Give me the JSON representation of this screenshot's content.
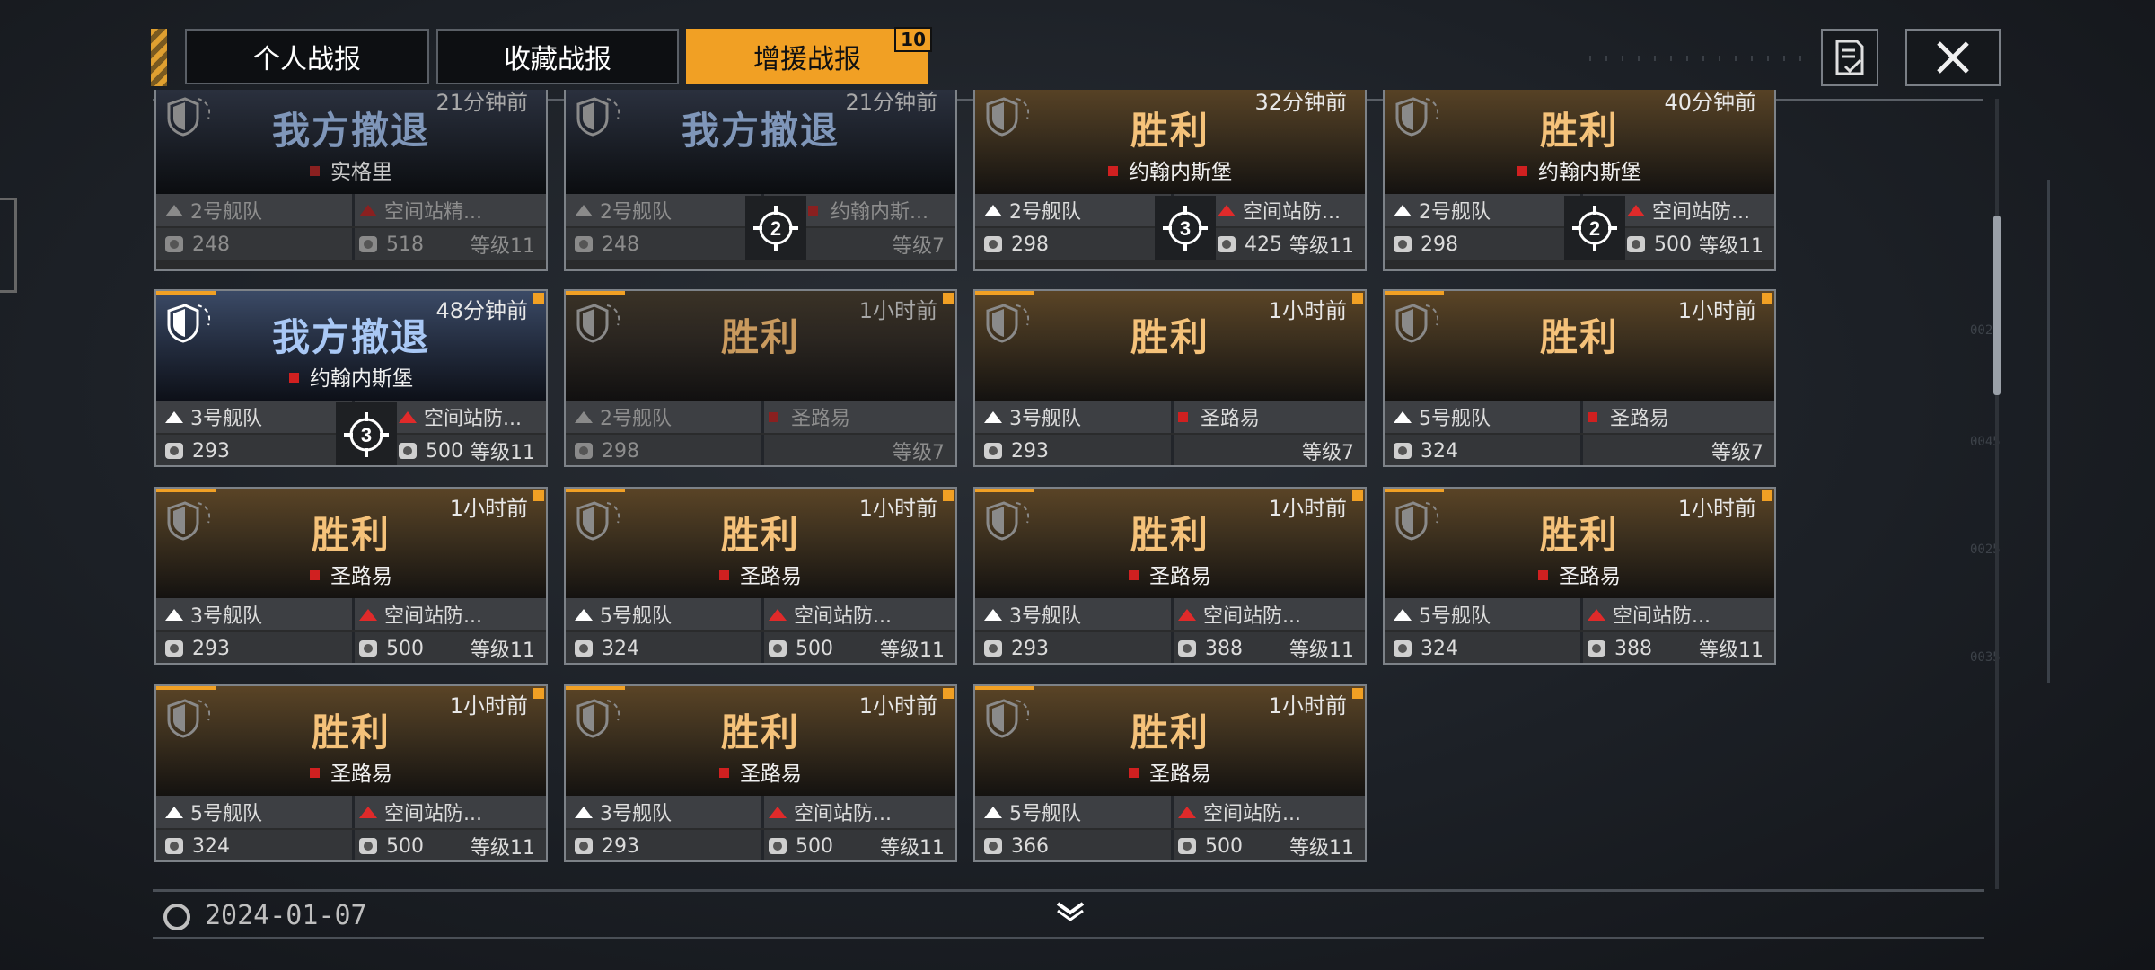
{
  "tabs": [
    {
      "label": "个人战报",
      "active": false
    },
    {
      "label": "收藏战报",
      "active": false
    },
    {
      "label": "增援战报",
      "active": true,
      "badge": "10"
    }
  ],
  "toolbar": {
    "report_icon": "report-list-icon",
    "close_icon": "close-icon"
  },
  "colors": {
    "accent": "#f1a024",
    "victory": "#f5c27a",
    "retreat": "#a9c8f5",
    "enemy_red": "#e02a2a"
  },
  "cards": [
    {
      "title": "我方撤退",
      "location": "实格里",
      "time": "21分钟前",
      "fleet": "2号舰队",
      "target": "空间站精...",
      "power": "248",
      "enemy_power": "518",
      "level": "等级11"
    },
    {
      "title": "我方撤退",
      "location": "",
      "time": "21分钟前",
      "fleet": "2号舰队",
      "target": "约翰内斯...",
      "power": "248",
      "enemy_power": "",
      "level": "等级7",
      "wave": "2"
    },
    {
      "title": "胜利",
      "location": "约翰内斯堡",
      "time": "32分钟前",
      "fleet": "2号舰队",
      "target": "空间站防...",
      "power": "298",
      "enemy_power": "425",
      "level": "等级11",
      "wave": "3"
    },
    {
      "title": "胜利",
      "location": "约翰内斯堡",
      "time": "40分钟前",
      "fleet": "2号舰队",
      "target": "空间站防...",
      "power": "298",
      "enemy_power": "500",
      "level": "等级11",
      "wave": "2"
    },
    {
      "title": "我方撤退",
      "location": "约翰内斯堡",
      "time": "48分钟前",
      "fleet": "3号舰队",
      "target": "空间站防...",
      "power": "293",
      "enemy_power": "500",
      "level": "等级11",
      "wave": "3"
    },
    {
      "title": "胜利",
      "location": "",
      "time": "1小时前",
      "fleet": "2号舰队",
      "target": "圣路易",
      "power": "298",
      "enemy_power": "",
      "level": "等级7"
    },
    {
      "title": "胜利",
      "location": "",
      "time": "1小时前",
      "fleet": "3号舰队",
      "target": "圣路易",
      "power": "293",
      "enemy_power": "",
      "level": "等级7"
    },
    {
      "title": "胜利",
      "location": "",
      "time": "1小时前",
      "fleet": "5号舰队",
      "target": "圣路易",
      "power": "324",
      "enemy_power": "",
      "level": "等级7"
    },
    {
      "title": "胜利",
      "location": "圣路易",
      "time": "1小时前",
      "fleet": "3号舰队",
      "target": "空间站防...",
      "power": "293",
      "enemy_power": "500",
      "level": "等级11"
    },
    {
      "title": "胜利",
      "location": "圣路易",
      "time": "1小时前",
      "fleet": "5号舰队",
      "target": "空间站防...",
      "power": "324",
      "enemy_power": "500",
      "level": "等级11"
    },
    {
      "title": "胜利",
      "location": "圣路易",
      "time": "1小时前",
      "fleet": "3号舰队",
      "target": "空间站防...",
      "power": "293",
      "enemy_power": "388",
      "level": "等级11"
    },
    {
      "title": "胜利",
      "location": "圣路易",
      "time": "1小时前",
      "fleet": "5号舰队",
      "target": "空间站防...",
      "power": "324",
      "enemy_power": "388",
      "level": "等级11"
    },
    {
      "title": "胜利",
      "location": "圣路易",
      "time": "1小时前",
      "fleet": "5号舰队",
      "target": "空间站防...",
      "power": "324",
      "enemy_power": "500",
      "level": "等级11"
    },
    {
      "title": "胜利",
      "location": "圣路易",
      "time": "1小时前",
      "fleet": "3号舰队",
      "target": "空间站防...",
      "power": "293",
      "enemy_power": "500",
      "level": "等级11"
    },
    {
      "title": "胜利",
      "location": "圣路易",
      "time": "1小时前",
      "fleet": "5号舰队",
      "target": "空间站防...",
      "power": "366",
      "enemy_power": "500",
      "level": "等级11"
    }
  ],
  "footer": {
    "date": "2024-01-07"
  }
}
